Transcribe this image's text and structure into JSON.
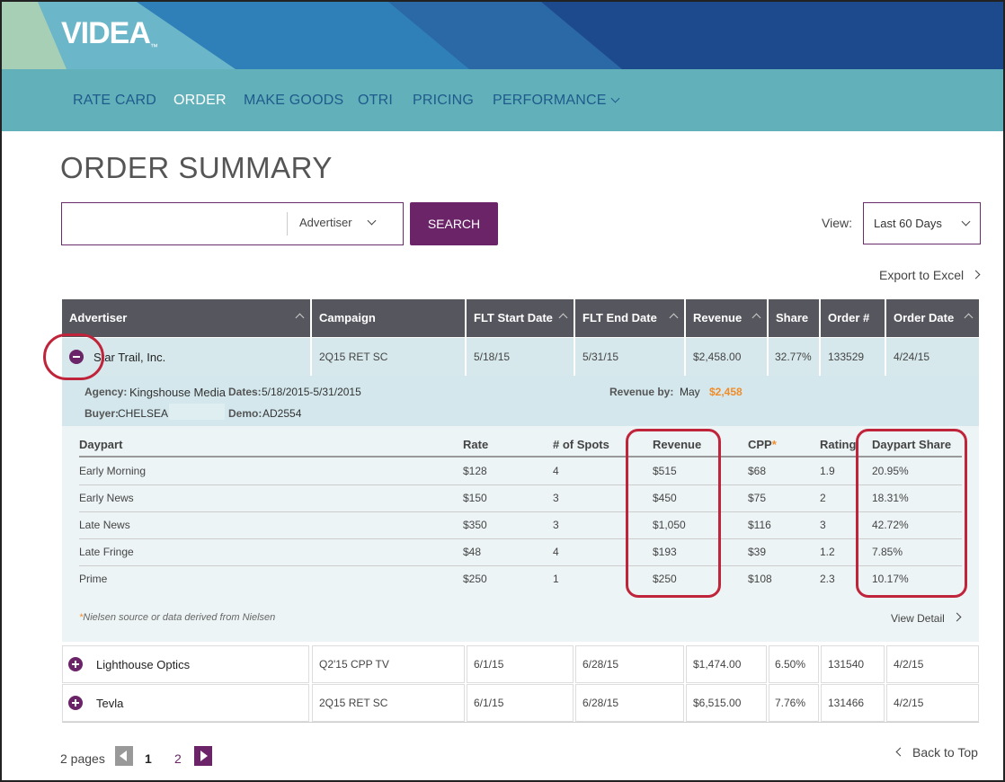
{
  "brand": {
    "logo": "VIDEA",
    "tm": "™"
  },
  "nav": {
    "items": [
      "RATE CARD",
      "ORDER",
      "MAKE GOODS",
      "OTRI",
      "PRICING",
      "PERFORMANCE"
    ],
    "active": "ORDER"
  },
  "page_title": "ORDER SUMMARY",
  "search": {
    "value": "",
    "filter": "Advertiser",
    "button": "SEARCH"
  },
  "view": {
    "label": "View:",
    "selected": "Last 60 Days"
  },
  "export_label": "Export to Excel",
  "table": {
    "columns": [
      "Advertiser",
      "Campaign",
      "FLT Start Date",
      "FLT End Date",
      "Revenue",
      "Share",
      "Order #",
      "Order Date"
    ],
    "rows": [
      {
        "advertiser": "Star Trail, Inc.",
        "campaign": "2Q15 RET SC",
        "start": "5/18/15",
        "end": "5/31/15",
        "revenue": "$2,458.00",
        "share": "32.77%",
        "order": "133529",
        "order_date": "4/24/15",
        "expanded": true
      },
      {
        "advertiser": "Lighthouse Optics",
        "campaign": "Q2'15 CPP TV",
        "start": "6/1/15",
        "end": "6/28/15",
        "revenue": "$1,474.00",
        "share": "6.50%",
        "order": "131540",
        "order_date": "4/2/15",
        "expanded": false
      },
      {
        "advertiser": "Tevla",
        "campaign": "2Q15 RET SC",
        "start": "6/1/15",
        "end": "6/28/15",
        "revenue": "$6,515.00",
        "share": "7.76%",
        "order": "131466",
        "order_date": "4/2/15",
        "expanded": false
      }
    ]
  },
  "detail": {
    "agency_label": "Agency:",
    "agency": "Kingshouse Media",
    "dates_label": "Dates:",
    "dates": "5/18/2015-5/31/2015",
    "revenue_by_label": "Revenue by:",
    "revenue_month": "May",
    "revenue_total": "$2,458",
    "buyer_label": "Buyer:",
    "buyer": "CHELSEA",
    "demo_label": "Demo:",
    "demo": "AD2554",
    "daypart_columns": [
      "Daypart",
      "Rate",
      "# of Spots",
      "Revenue",
      "CPP",
      "Rating",
      "Daypart Share"
    ],
    "cpp_asterisk": "*",
    "dayparts": [
      {
        "name": "Early Morning",
        "rate": "$128",
        "spots": "4",
        "revenue": "$515",
        "cpp": "$68",
        "rating": "1.9",
        "share": "20.95%"
      },
      {
        "name": "Early News",
        "rate": "$150",
        "spots": "3",
        "revenue": "$450",
        "cpp": "$75",
        "rating": "2",
        "share": "18.31%"
      },
      {
        "name": "Late News",
        "rate": "$350",
        "spots": "3",
        "revenue": "$1,050",
        "cpp": "$116",
        "rating": "3",
        "share": "42.72%"
      },
      {
        "name": "Late Fringe",
        "rate": "$48",
        "spots": "4",
        "revenue": "$193",
        "cpp": "$39",
        "rating": "1.2",
        "share": "7.85%"
      },
      {
        "name": "Prime",
        "rate": "$250",
        "spots": "1",
        "revenue": "$250",
        "cpp": "$108",
        "rating": "2.3",
        "share": "10.17%"
      }
    ],
    "footnote_star": "*",
    "footnote": "Nielsen source or data derived from Nielsen",
    "view_detail": "View Detail"
  },
  "pagination": {
    "pages_label": "2 pages",
    "page1": "1",
    "page2": "2",
    "back_to_top": "Back to Top"
  },
  "colors": {
    "accent": "#6b2468",
    "nav": "#62b1ba",
    "highlight": "#c0243a",
    "revenue_total": "#f28c28"
  }
}
